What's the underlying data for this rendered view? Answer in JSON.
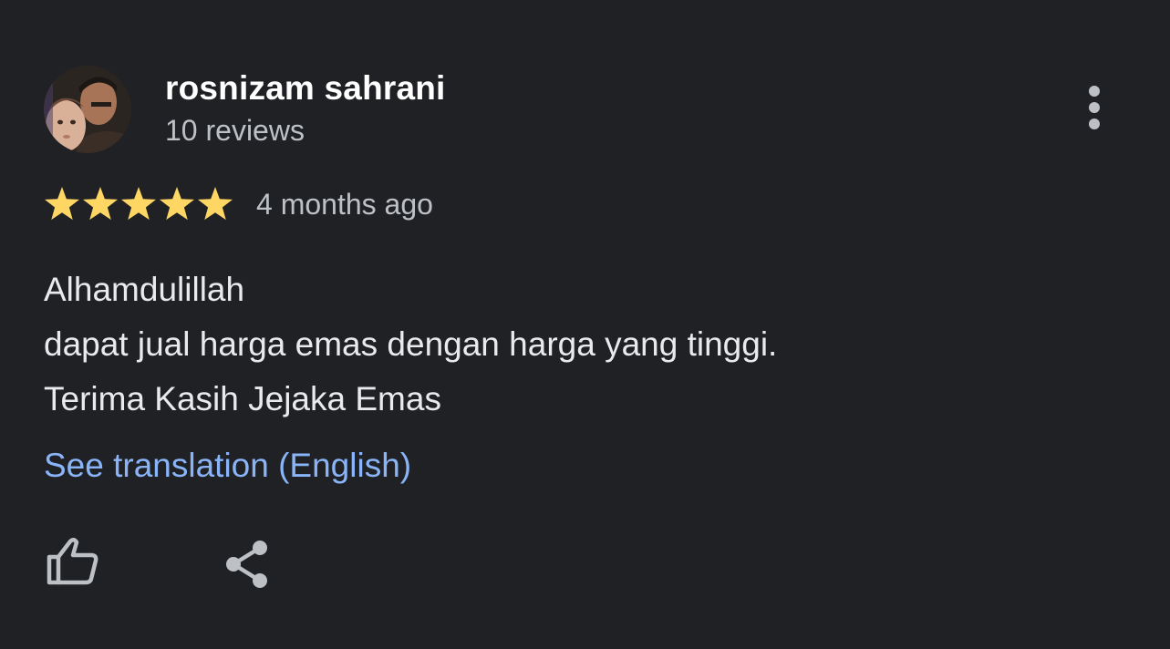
{
  "reviewer": {
    "name": "rosnizam sahrani",
    "reviews_count": "10 reviews",
    "avatar_icon": "profile-photo"
  },
  "review": {
    "rating": 5,
    "rating_max": 5,
    "time": "4 months ago",
    "text_lines": [
      "Alhamdulillah",
      "dapat jual harga emas dengan harga yang tinggi.",
      "Terima Kasih Jejaka Emas"
    ],
    "translation_link": "See translation (English)"
  },
  "actions": {
    "more_icon": "more-vertical-icon",
    "like_icon": "thumbs-up-icon",
    "share_icon": "share-icon"
  },
  "colors": {
    "background": "#202124",
    "star": "#fdd663",
    "link": "#8ab4f8",
    "primary_text": "#ffffff",
    "secondary_text": "#bdc1c6",
    "icon": "#bdc1c6"
  }
}
